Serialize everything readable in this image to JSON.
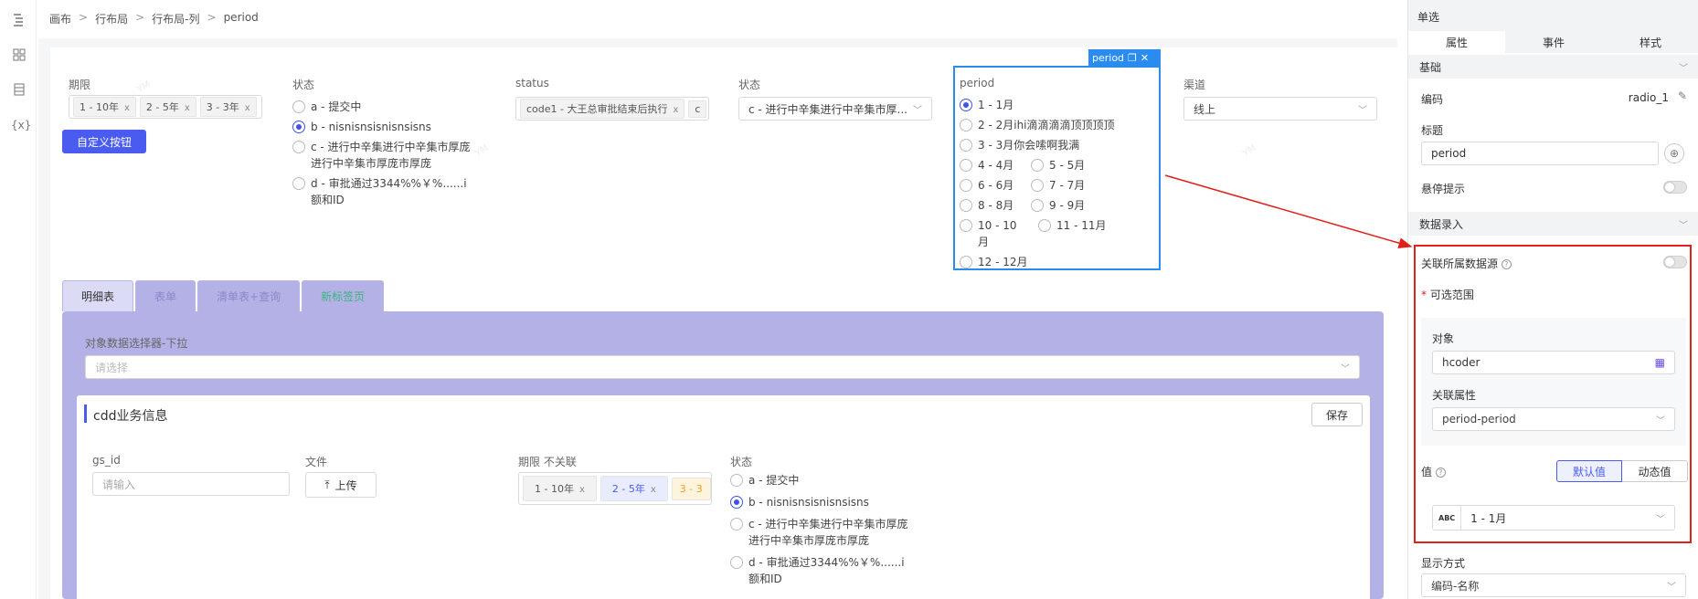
{
  "breadcrumb": [
    "画布",
    "行布局",
    "行布局-列",
    "period"
  ],
  "rail": [
    "outline-icon",
    "components-icon",
    "datasource-icon",
    "variables-icon"
  ],
  "rail_var_label": "{x}",
  "fields": {
    "term": {
      "label": "期限",
      "tags": [
        "1 - 10年",
        "2 - 5年",
        "3 - 3年"
      ]
    },
    "status1": {
      "label": "状态",
      "options": [
        "a - 提交中",
        "b - nisnisnsisnisnsisns",
        "c - 进行中辛集进行中辛集市厚庞进行中辛集市厚庞市厚庞",
        "d - 审批通过3344%%￥%......i额和ID"
      ],
      "selected": 1
    },
    "status_en": {
      "label": "status",
      "tags": [
        "code1 - 大王总审批结束后执行",
        "c"
      ]
    },
    "status2": {
      "label": "状态",
      "value": "c - 进行中辛集进行中辛集市厚..."
    },
    "period": {
      "label": "period",
      "badge": "period",
      "options": [
        "1 - 1月",
        "2 - 2月ihi滴滴滴滴顶顶顶顶",
        "3 - 3月你会嗦啊我满",
        "4 - 4月",
        "5 - 5月",
        "6 - 6月",
        "7 - 7月",
        "8 - 8月",
        "9 - 9月",
        "10 - 10月",
        "11 - 11月",
        "12 - 12月"
      ],
      "selected": 0
    },
    "channel": {
      "label": "渠道",
      "value": "线上"
    }
  },
  "custom_button": "自定义按钮",
  "tabs": [
    "明细表",
    "表单",
    "清单表+查询",
    "新标签页"
  ],
  "object_selector": {
    "label": "对象数据选择器-下拉",
    "placeholder": "请选择"
  },
  "section": {
    "title": "cdd业务信息",
    "save": "保存",
    "gs_id": {
      "label": "gs_id",
      "placeholder": "请输入"
    },
    "file": {
      "label": "文件",
      "upload": "上传"
    },
    "term2": {
      "label": "期限 不关联",
      "tags": [
        "1 - 10年",
        "2 - 5年",
        "3 - 3"
      ]
    },
    "status": {
      "label": "状态",
      "options": [
        "a - 提交中",
        "b - nisnisnsisnisnsisns",
        "c - 进行中辛集进行中辛集市厚庞进行中辛集市厚庞市厚庞",
        "d - 审批通过3344%%￥%......i额和ID"
      ],
      "selected": 1
    }
  },
  "panel": {
    "title": "单选",
    "tabs": [
      "属性",
      "事件",
      "样式"
    ],
    "basic": "基础",
    "code_label": "编码",
    "code_value": "radio_1",
    "title_label": "标题",
    "title_value": "period",
    "tooltip_label": "悬停提示",
    "data_entry": "数据录入",
    "link_ds": "关联所属数据源",
    "range_label": "可选范围",
    "object_label": "对象",
    "object_value": "hcoder",
    "attr_label": "关联属性",
    "attr_value": "period-period",
    "value_label": "值",
    "default_btn": "默认值",
    "dynamic_btn": "动态值",
    "abc": "ABC",
    "value_value": "1 - 1月",
    "display_label": "显示方式",
    "display_value": "编码-名称"
  },
  "watermark": "YM",
  "colors": {
    "primary": "#4a5cf0",
    "highlight": "#2b8cf0",
    "annotation": "#e0201a",
    "tab_bg": "#b3b1e6"
  }
}
